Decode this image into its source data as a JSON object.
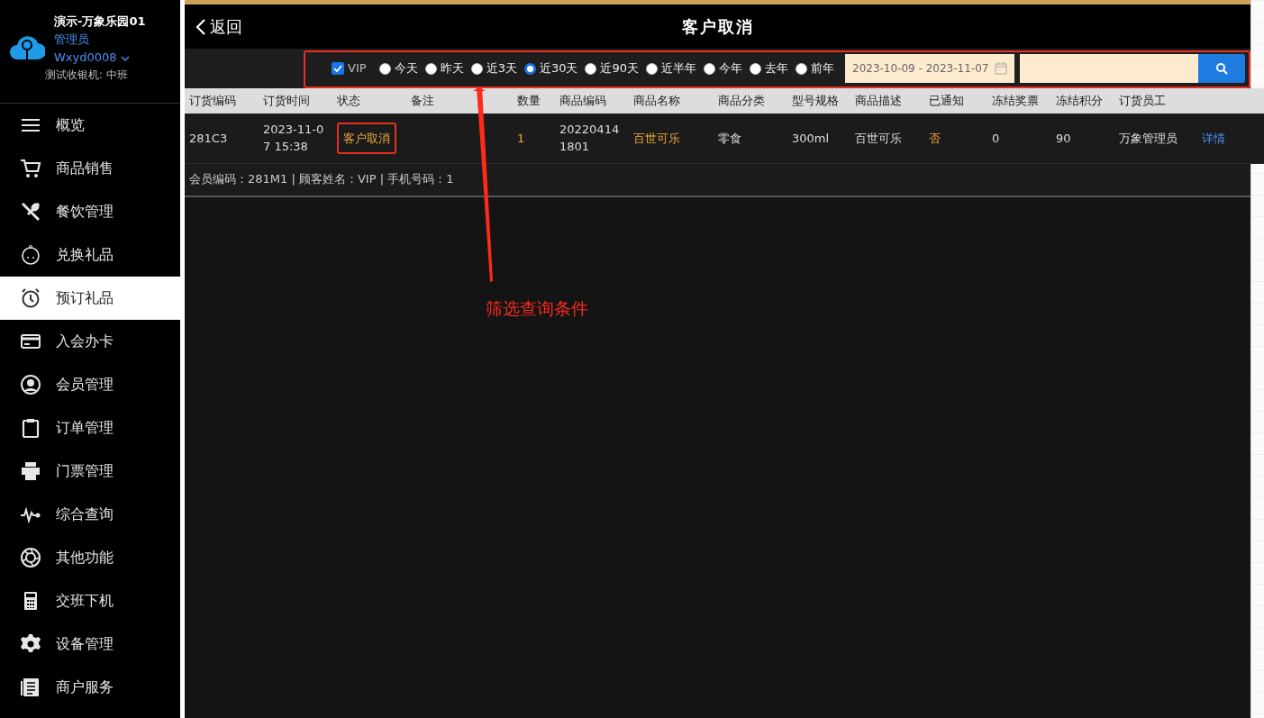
{
  "sidebar": {
    "store_name": "演示-万象乐园01",
    "role": "管理员",
    "account": "Wxyd0008",
    "terminal": "测试收银机: 中班",
    "items": [
      {
        "label": "概览",
        "selected": false
      },
      {
        "label": "商品销售",
        "selected": false
      },
      {
        "label": "餐饮管理",
        "selected": false
      },
      {
        "label": "兑换礼品",
        "selected": false
      },
      {
        "label": "预订礼品",
        "selected": true
      },
      {
        "label": "入会办卡",
        "selected": false
      },
      {
        "label": "会员管理",
        "selected": false
      },
      {
        "label": "订单管理",
        "selected": false
      },
      {
        "label": "门票管理",
        "selected": false
      },
      {
        "label": "综合查询",
        "selected": false
      },
      {
        "label": "其他功能",
        "selected": false
      },
      {
        "label": "交班下机",
        "selected": false
      },
      {
        "label": "设备管理",
        "selected": false
      },
      {
        "label": "商户服务",
        "selected": false
      }
    ]
  },
  "header": {
    "back": "返回",
    "title": "客户取消"
  },
  "filter": {
    "vip": {
      "label": "VIP",
      "checked": true
    },
    "periods": [
      {
        "label": "今天",
        "selected": false
      },
      {
        "label": "昨天",
        "selected": false
      },
      {
        "label": "近3天",
        "selected": false
      },
      {
        "label": "近30天",
        "selected": true
      },
      {
        "label": "近90天",
        "selected": false
      },
      {
        "label": "近半年",
        "selected": false
      },
      {
        "label": "今年",
        "selected": false
      },
      {
        "label": "去年",
        "selected": false
      },
      {
        "label": "前年",
        "selected": false
      }
    ],
    "date_range": "2023-10-09 - 2023-11-07"
  },
  "table": {
    "columns": [
      "订货编码",
      "订货时间",
      "状态",
      "备注",
      "数量",
      "商品编码",
      "商品名称",
      "商品分类",
      "型号规格",
      "商品描述",
      "已通知",
      "冻结奖票",
      "冻结积分",
      "订货员工"
    ],
    "rows": [
      {
        "cells": [
          {
            "text": "281C3",
            "kind": "plain"
          },
          {
            "text": "2023-11-07 15:38",
            "kind": "plain"
          },
          {
            "text": "客户取消",
            "kind": "accent"
          },
          {
            "text": "",
            "kind": "plain"
          },
          {
            "text": "1",
            "kind": "accent"
          },
          {
            "text": "202204141801",
            "kind": "plain"
          },
          {
            "text": "百世可乐",
            "kind": "accent"
          },
          {
            "text": "零食",
            "kind": "plain"
          },
          {
            "text": "300ml",
            "kind": "plain"
          },
          {
            "text": "百世可乐",
            "kind": "plain"
          },
          {
            "text": "否",
            "kind": "accent"
          },
          {
            "text": "0",
            "kind": "plain"
          },
          {
            "text": "90",
            "kind": "plain"
          },
          {
            "text": "万象管理员",
            "kind": "plain"
          },
          {
            "text": "详情",
            "kind": "link"
          }
        ],
        "member_info": "会员编码：281M1 | 顾客姓名：VIP | 手机号码：1"
      }
    ]
  },
  "annotation": {
    "label": "筛选查询条件"
  }
}
